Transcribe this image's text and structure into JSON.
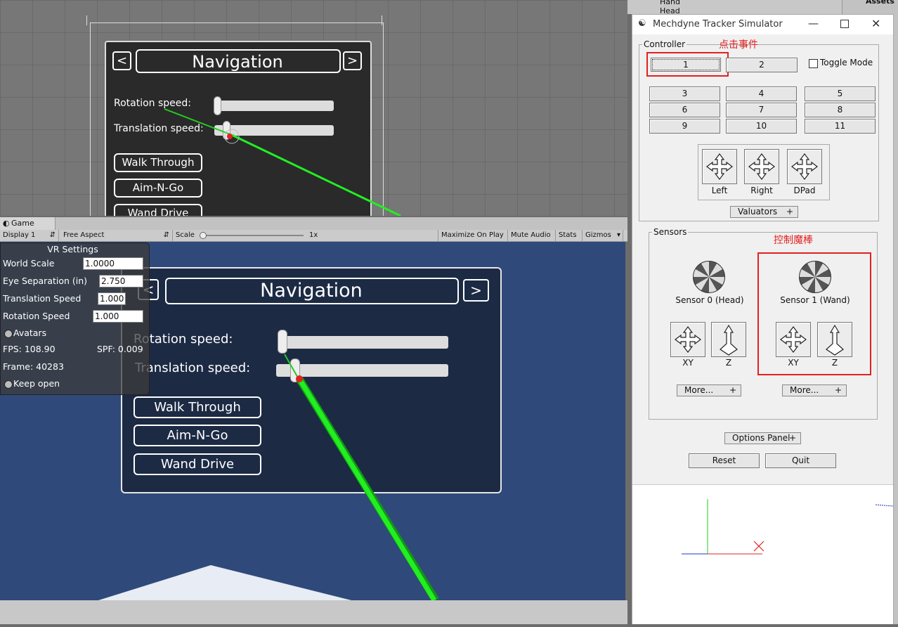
{
  "scene": {
    "nav_title": "Navigation",
    "prev": "<",
    "next": ">",
    "rotation_label": "Rotation speed:",
    "translation_label": "Translation speed:",
    "modes": [
      "Walk Through",
      "Aim-N-Go",
      "Wand Drive"
    ]
  },
  "game_tab": {
    "label": "Game"
  },
  "toolbar": {
    "display": "Display 1",
    "aspect": "Free Aspect",
    "scale_label": "Scale",
    "scale_value": "1x",
    "maximize": "Maximize On Play",
    "mute": "Mute Audio",
    "stats": "Stats",
    "gizmos": "Gizmos"
  },
  "vr_settings": {
    "title": "VR Settings",
    "world_scale_label": "World Scale",
    "world_scale_value": "1.0000",
    "eye_sep_label": "Eye Separation (in)",
    "eye_sep_value": "2.750",
    "trans_speed_label": "Translation Speed",
    "trans_speed_value": "1.000",
    "rot_speed_label": "Rotation Speed",
    "rot_speed_value": "1.000",
    "avatars_label": "Avatars",
    "fps": "FPS: 108.90",
    "spf": "SPF: 0.009",
    "frame": "Frame: 40283",
    "keep_open": "Keep open"
  },
  "game_nav": {
    "nav_title": "Navigation",
    "prev": "<",
    "next": ">",
    "rotation_label": "Rotation speed:",
    "translation_label": "Translation speed:",
    "modes": [
      "Walk Through",
      "Aim-N-Go",
      "Wand Drive"
    ]
  },
  "project": {
    "items": [
      "Hand",
      "Head"
    ],
    "assets": "Assets"
  },
  "simulator": {
    "title": "Mechdyne Tracker Simulator",
    "controller_label": "Controller",
    "annotation_click": "点击事件",
    "toggle_mode": "Toggle Mode",
    "buttons": [
      "1",
      "2",
      "3",
      "4",
      "5",
      "6",
      "7",
      "8",
      "9",
      "10",
      "11"
    ],
    "dir_buttons": [
      "Left",
      "Right",
      "DPad"
    ],
    "valuators": "Valuators",
    "sensors_label": "Sensors",
    "annotation_wand": "控制魔棒",
    "sensor0": "Sensor 0 (Head)",
    "sensor1": "Sensor 1 (Wand)",
    "xy": "XY",
    "z": "Z",
    "more": "More...",
    "options_panel": "Options Panel",
    "reset": "Reset",
    "quit": "Quit"
  },
  "colors": {
    "annotation": "#e32020",
    "laser": "#22ee22",
    "game_bg": "#2f4a7a"
  }
}
